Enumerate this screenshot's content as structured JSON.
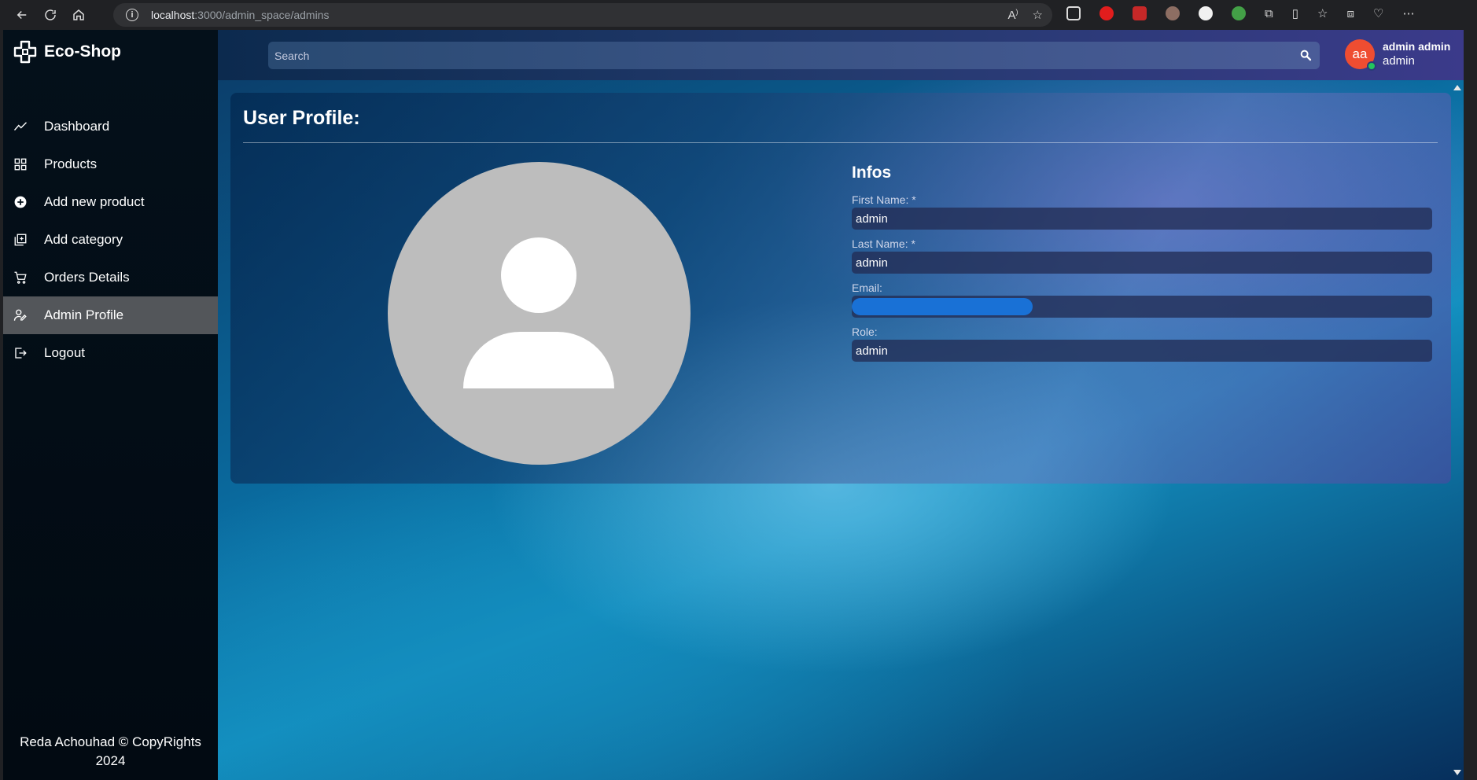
{
  "browser": {
    "url_host": "localhost",
    "url_path": ":3000/admin_space/admins"
  },
  "brand": {
    "name": "Eco-Shop"
  },
  "sidebar": {
    "items": [
      {
        "label": "Dashboard",
        "icon": "chart-line-icon"
      },
      {
        "label": "Products",
        "icon": "grid-icon"
      },
      {
        "label": "Add new product",
        "icon": "plus-circle-icon"
      },
      {
        "label": "Add category",
        "icon": "layers-plus-icon"
      },
      {
        "label": "Orders Details",
        "icon": "cart-icon"
      },
      {
        "label": "Admin Profile",
        "icon": "user-edit-icon",
        "active": true
      },
      {
        "label": "Logout",
        "icon": "logout-icon"
      }
    ],
    "footer_line1": "Reda Achouhad © CopyRights",
    "footer_line2": "2024"
  },
  "header": {
    "search_placeholder": "Search",
    "user_initials": "aa",
    "user_name": "admin admin",
    "user_role": "admin"
  },
  "profile": {
    "title": "User Profile:",
    "infos_title": "Infos",
    "fields": [
      {
        "label": "First Name: *",
        "value": "admin"
      },
      {
        "label": "Last Name: *",
        "value": "admin"
      },
      {
        "label": "Email:",
        "value": ""
      },
      {
        "label": "Role:",
        "value": "admin"
      }
    ]
  },
  "colors": {
    "sidebar_active": "#53565a",
    "avatar_bg": "#ef4d31",
    "online_dot": "#22c55e",
    "redaction": "#1971d6"
  }
}
